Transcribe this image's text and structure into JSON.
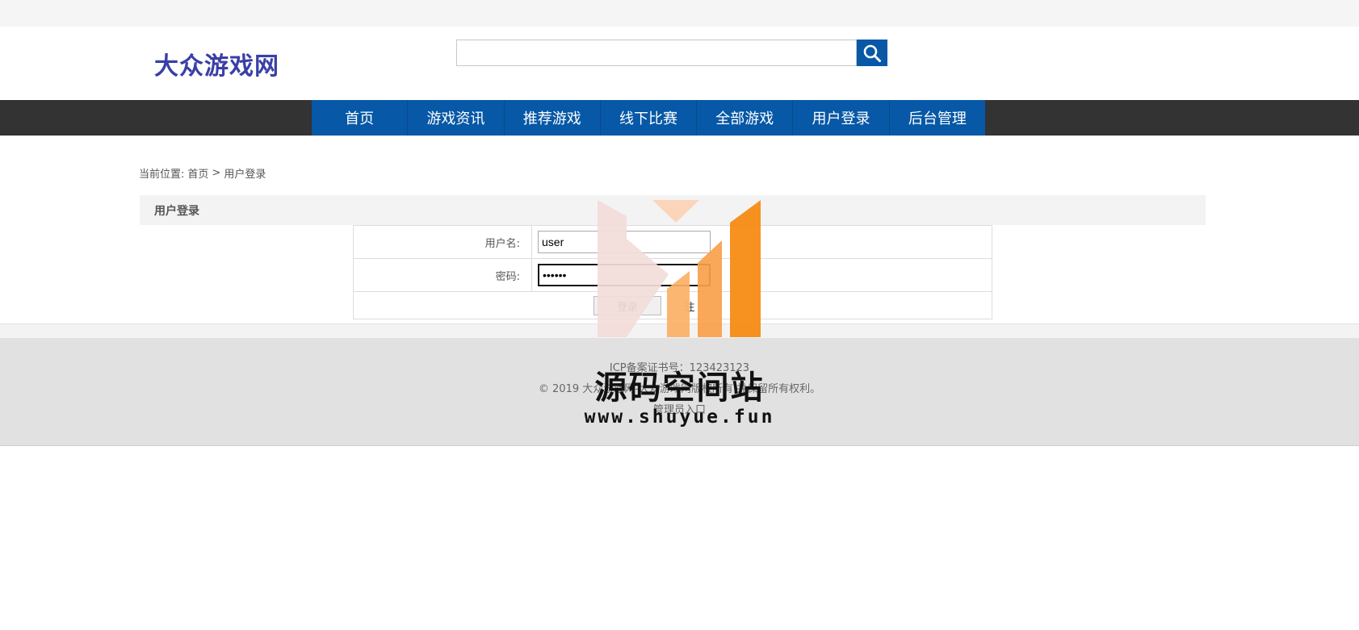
{
  "header": {
    "logo": "大众游戏网"
  },
  "search": {
    "value": "",
    "placeholder": ""
  },
  "nav": [
    "首页",
    "游戏资讯",
    "推荐游戏",
    "线下比赛",
    "全部游戏",
    "用户登录",
    "后台管理"
  ],
  "breadcrumb": {
    "prefix": "当前位置:",
    "home": "首页",
    "separator": ">",
    "current": "用户登录"
  },
  "panel": {
    "title": "用户登录"
  },
  "form": {
    "username_label": "用户名:",
    "username_value": "user",
    "password_label": "密码:",
    "password_value": "••••••",
    "login_button": "登录",
    "register_button": "注"
  },
  "footer": {
    "icp": "ICP备案证书号：123423123",
    "copyright": "© 2019 大众游戏网-大众游戏网版权所有 并保留所有权利。",
    "admin_link": "管理员入口"
  },
  "watermark": {
    "title": "源码空间站",
    "url": "www.shuyue.fun"
  },
  "colors": {
    "brand_blue": "#0758a6",
    "logo_blue": "#3a3fa6",
    "nav_bar": "#333333",
    "footer_bg": "#e1e1e1",
    "watermark_orange": "#f7890f"
  }
}
